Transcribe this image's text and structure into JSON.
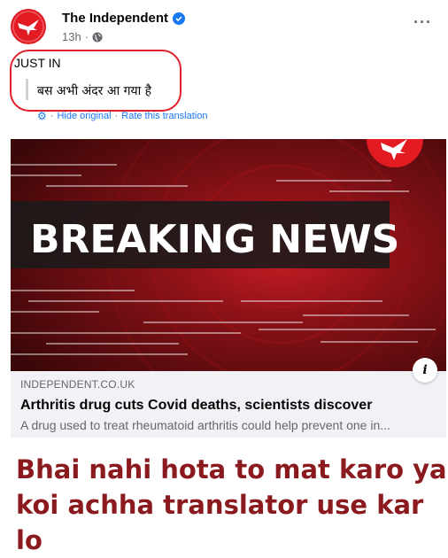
{
  "post": {
    "page_name": "The Independent",
    "timestamp": "13h",
    "more_icon": "more-icon",
    "original_text": "JUST IN",
    "translated_text": "बस अभी अंदर आ गया है",
    "translation_links": {
      "hide_original": "Hide original",
      "rate_translation": "Rate this translation"
    }
  },
  "link_card": {
    "image_text": "BREAKING NEWS",
    "domain": "INDEPENDENT.CO.UK",
    "headline": "Arthritis drug cuts Covid deaths, scientists discover",
    "description": "A drug used to treat rheumatoid arthritis could help prevent one in..."
  },
  "caption": {
    "line1": "Bhai nahi hota to mat karo ya",
    "line2": "koi achha translator use kar lo"
  },
  "colors": {
    "brand_red": "#e31b23",
    "link_blue": "#1877f2",
    "caption_red": "#8b1a1f",
    "annotation_red": "#e0202a"
  }
}
